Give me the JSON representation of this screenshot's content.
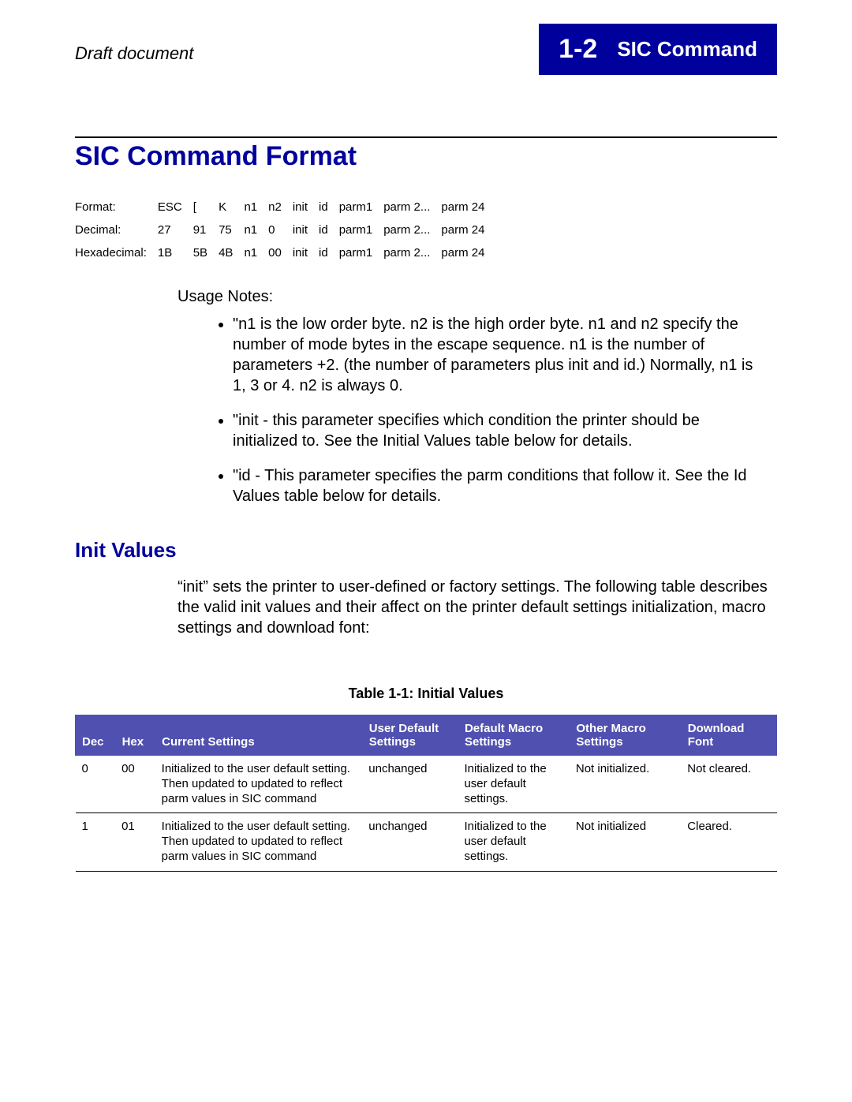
{
  "header": {
    "draft": "Draft document",
    "page_num": "1-2",
    "page_title": "SIC Command"
  },
  "section_title": "SIC Command Format",
  "format_table": {
    "rows": [
      {
        "label": "Format:",
        "c": [
          "ESC",
          "[",
          "K",
          "n1",
          "n2",
          "init",
          "id",
          "parm1",
          "parm 2...",
          "parm 24"
        ]
      },
      {
        "label": "Decimal:",
        "c": [
          "27",
          "91",
          "75",
          "n1",
          "0",
          "init",
          "id",
          "parm1",
          "parm 2...",
          "parm 24"
        ]
      },
      {
        "label": "Hexadecimal:",
        "c": [
          "1B",
          "5B",
          "4B",
          "n1",
          "00",
          "init",
          "id",
          "parm1",
          "parm 2...",
          "parm 24"
        ]
      }
    ]
  },
  "usage_label": "Usage Notes:",
  "notes": [
    "\"n1 is the low order byte.  n2 is the high order byte.  n1 and n2 specify the number of mode bytes in the escape sequence.  n1 is the number of parameters +2.  (the number of parameters plus init and id.) Normally, n1 is 1, 3 or 4.  n2 is always 0.",
    "\"init - this parameter specifies which condition the printer should be initialized to.  See the Initial Values table below for details.",
    "\"id - This parameter specifies the parm conditions that follow it.  See the Id Values table below for details."
  ],
  "subsection_title": "Init Values",
  "subsection_para": "“init” sets the printer to user-defined or factory settings. The following table describes the valid init values and their affect on the printer default settings initialization, macro settings and download font:",
  "table_caption": "Table 1-1:  Initial Values",
  "init_table": {
    "headers": [
      "Dec",
      "Hex",
      "Current Settings",
      "User Default Settings",
      "Default Macro Settings",
      "Other Macro Settings",
      "Download Font"
    ],
    "rows": [
      {
        "dec": "0",
        "hex": "00",
        "current": "Initialized to the user default setting.\nThen updated to updated to reflect parm values in SIC command",
        "user": "unchanged",
        "defmac": "Initialized to the user default settings.",
        "othmac": "Not initialized.",
        "dl": "Not cleared."
      },
      {
        "dec": "1",
        "hex": "01",
        "current": "Initialized to the user default setting.\nThen updated to updated to reflect parm values in SIC command",
        "user": "unchanged",
        "defmac": "Initialized to the user default settings.",
        "othmac": "Not initialized",
        "dl": "Cleared."
      }
    ]
  }
}
